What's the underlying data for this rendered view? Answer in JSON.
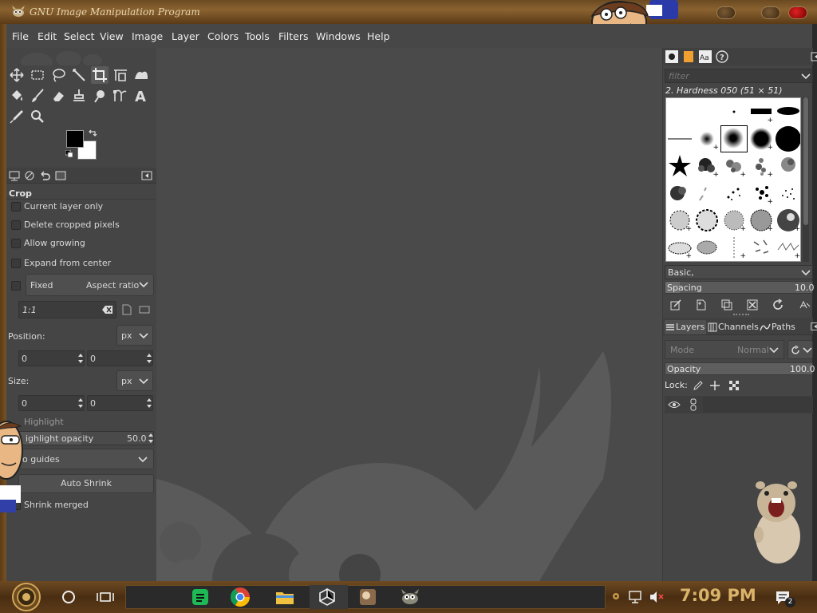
{
  "window": {
    "title": "GNU Image Manipulation Program"
  },
  "menu": {
    "items": [
      "File",
      "Edit",
      "Select",
      "View",
      "Image",
      "Layer",
      "Colors",
      "Tools",
      "Filters",
      "Windows",
      "Help"
    ]
  },
  "toolbox": {
    "tools": [
      "move-tool-icon",
      "rect-select-tool-icon",
      "lasso-tool-icon",
      "fuzzy-select-tool-icon",
      "crop-tool-icon",
      "unified-transform-tool-icon",
      "warp-transform-tool-icon",
      "bucket-fill-tool-icon",
      "paintbrush-tool-icon",
      "eraser-tool-icon",
      "clone-tool-icon",
      "smudge-tool-icon",
      "paths-tool-icon",
      "text-tool-icon",
      "color-picker-tool-icon",
      "zoom-tool-icon"
    ],
    "active_tool": "crop-tool-icon",
    "foreground_color": "#000000",
    "background_color": "#ffffff"
  },
  "tool_options": {
    "title": "Crop",
    "current_layer_only": "Current layer only",
    "delete_cropped_pixels": "Delete cropped pixels",
    "allow_growing": "Allow growing",
    "expand_from_center": "Expand from center",
    "fixed_label": "Fixed",
    "fixed_value": "Aspect ratio",
    "ratio_value": "1:1",
    "position_label": "Position:",
    "position_unit": "px",
    "position_x": "0",
    "position_y": "0",
    "size_label": "Size:",
    "size_unit": "px",
    "size_w": "0",
    "size_h": "0",
    "highlight_label": "Highlight",
    "highlight_opacity_label": "ighlight opacity",
    "highlight_opacity_value": "50.0",
    "guides_value": "o guides",
    "auto_shrink_label": "Auto Shrink",
    "shrink_merged_label": "Shrink merged"
  },
  "brushes": {
    "filter_placeholder": "filter",
    "selected_brush": "2. Hardness 050 (51 × 51)",
    "preset": "Basic,",
    "spacing_label": "Spacing",
    "spacing_value": "10.0"
  },
  "layers": {
    "tab_layers": "Layers",
    "tab_channels": "Channels",
    "tab_paths": "Paths",
    "mode_label": "Mode",
    "mode_value": "Normal",
    "opacity_label": "Opacity",
    "opacity_value": "100.0",
    "lock_label": "Lock:"
  },
  "taskbar": {
    "clock": "7:09 PM",
    "notification_count": "2",
    "apps": [
      "spreadsheet-app-icon",
      "chrome-icon",
      "file-explorer-icon",
      "unity-icon",
      "app-icon",
      "gimp-icon"
    ]
  }
}
